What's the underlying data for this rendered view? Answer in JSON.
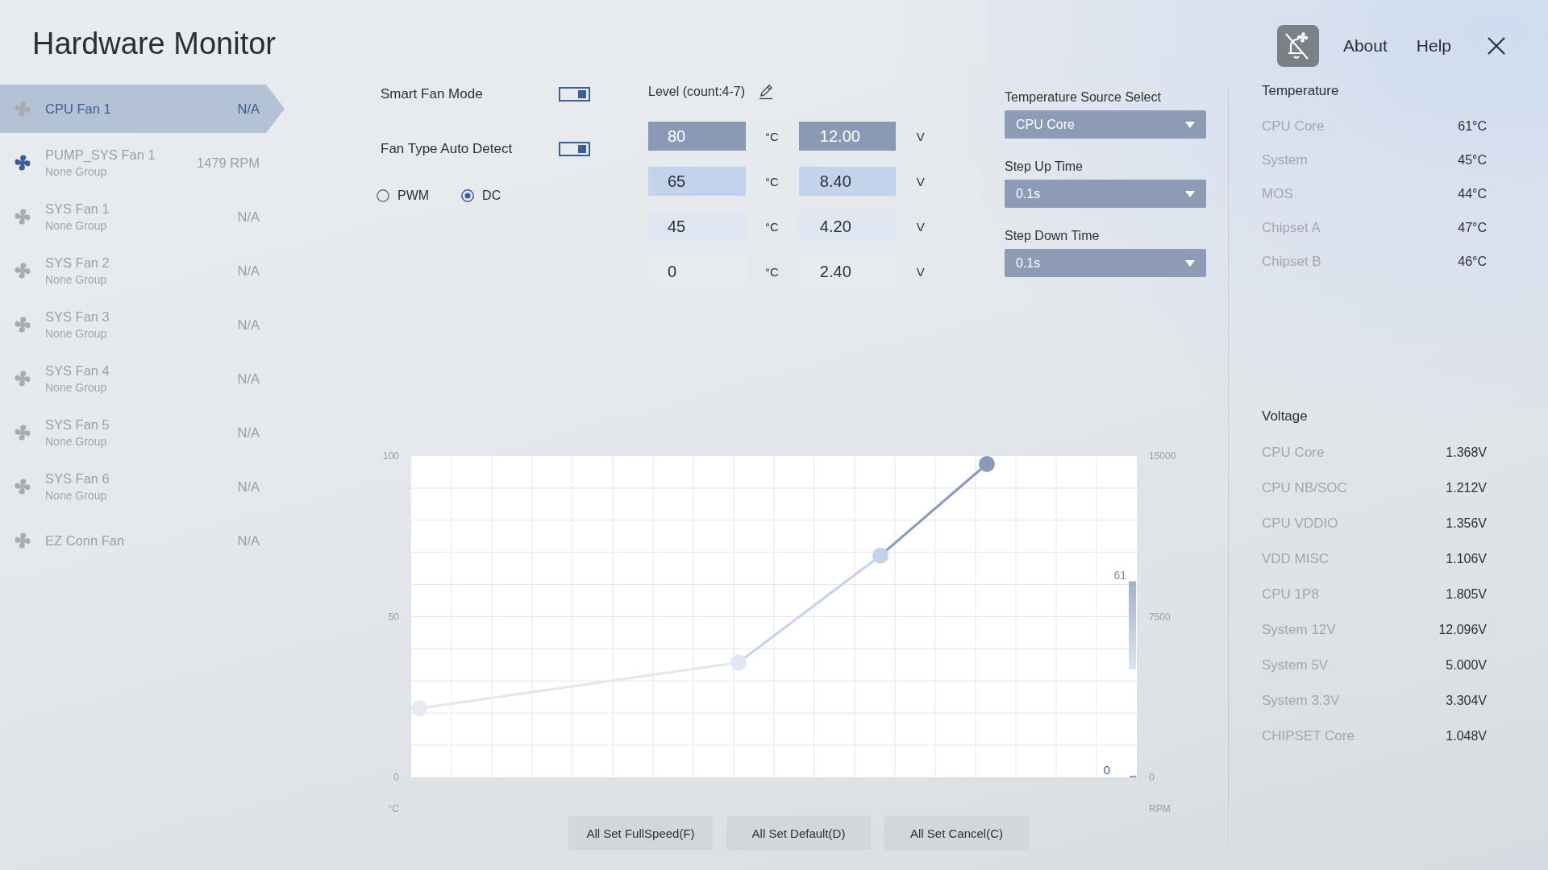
{
  "header": {
    "title": "Hardware Monitor",
    "links": [
      {
        "label": "About"
      },
      {
        "label": "Help"
      }
    ]
  },
  "sidebar": {
    "fans": [
      {
        "name": "CPU Fan 1",
        "reading": "N/A",
        "selected": true,
        "running": false
      },
      {
        "name": "PUMP_SYS Fan 1",
        "group": "None Group",
        "reading": "1479 RPM",
        "selected": false,
        "running": true
      },
      {
        "name": "SYS Fan 1",
        "group": "None Group",
        "reading": "N/A",
        "selected": false,
        "running": false
      },
      {
        "name": "SYS Fan 2",
        "group": "None Group",
        "reading": "N/A",
        "selected": false,
        "running": false
      },
      {
        "name": "SYS Fan 3",
        "group": "None Group",
        "reading": "N/A",
        "selected": false,
        "running": false
      },
      {
        "name": "SYS Fan 4",
        "group": "None Group",
        "reading": "N/A",
        "selected": false,
        "running": false
      },
      {
        "name": "SYS Fan 5",
        "group": "None Group",
        "reading": "N/A",
        "selected": false,
        "running": false
      },
      {
        "name": "SYS Fan 6",
        "group": "None Group",
        "reading": "N/A",
        "selected": false,
        "running": false
      },
      {
        "name": "EZ Conn Fan",
        "reading": "N/A",
        "selected": false,
        "running": false
      }
    ]
  },
  "fan_settings": {
    "toggles": [
      {
        "label": "Smart Fan Mode",
        "on": true
      },
      {
        "label": "Fan Type Auto Detect",
        "on": true
      }
    ],
    "fan_type": [
      {
        "label": "PWM",
        "selected": false
      },
      {
        "label": "DC",
        "selected": true
      }
    ]
  },
  "levels": {
    "title": "Level (count:4-7)",
    "rows": [
      {
        "temperature": "80",
        "temperature_unit": "°C",
        "voltage": "12.00",
        "voltage_unit": "V",
        "color": "#8a9ab6"
      },
      {
        "temperature": "65",
        "temperature_unit": "°C",
        "voltage": "8.40",
        "voltage_unit": "V",
        "color": "#c3d3ec"
      },
      {
        "temperature": "45",
        "temperature_unit": "°C",
        "voltage": "4.20",
        "voltage_unit": "V",
        "color": "#dfe7f3"
      },
      {
        "temperature": "0",
        "temperature_unit": "°C",
        "voltage": "2.40",
        "voltage_unit": "V",
        "color": "#e7eaee"
      }
    ]
  },
  "dropdowns": [
    {
      "label": "Temperature Source Select",
      "value": "CPU Core"
    },
    {
      "label": "Step Up Time",
      "value": "0.1s"
    },
    {
      "label": "Step Down Time",
      "value": "0.1s"
    }
  ],
  "chart": {
    "left_axis": {
      "label": "°C",
      "ticks": [
        "100",
        "50",
        "0"
      ]
    },
    "right_axis": {
      "label": "RPM",
      "ticks": [
        "15000",
        "7500",
        "0"
      ]
    },
    "temperature_gauge": {
      "reading": "61"
    },
    "rpm_gauge": {
      "reading": "0"
    }
  },
  "actions": [
    "All Set FullSpeed(F)",
    "All Set Default(D)",
    "All Set Cancel(C)"
  ],
  "temperature": {
    "title": "Temperature",
    "readings": [
      {
        "label": "CPU Core",
        "value": "61°C"
      },
      {
        "label": "System",
        "value": "45°C"
      },
      {
        "label": "MOS",
        "value": "44°C"
      },
      {
        "label": "Chipset A",
        "value": "47°C"
      },
      {
        "label": "Chipset B",
        "value": "46°C"
      }
    ]
  },
  "voltage": {
    "title": "Voltage",
    "readings": [
      {
        "label": "CPU Core",
        "value": "1.368V"
      },
      {
        "label": "CPU NB/SOC",
        "value": "1.212V"
      },
      {
        "label": "CPU VDDIO",
        "value": "1.356V"
      },
      {
        "label": "VDD MISC",
        "value": "1.106V"
      },
      {
        "label": "CPU 1P8",
        "value": "1.805V"
      },
      {
        "label": "System 12V",
        "value": "12.096V"
      },
      {
        "label": "System 5V",
        "value": "5.000V"
      },
      {
        "label": "System 3.3V",
        "value": "3.304V"
      },
      {
        "label": "CHIPSET Core",
        "value": "1.048V"
      }
    ]
  }
}
